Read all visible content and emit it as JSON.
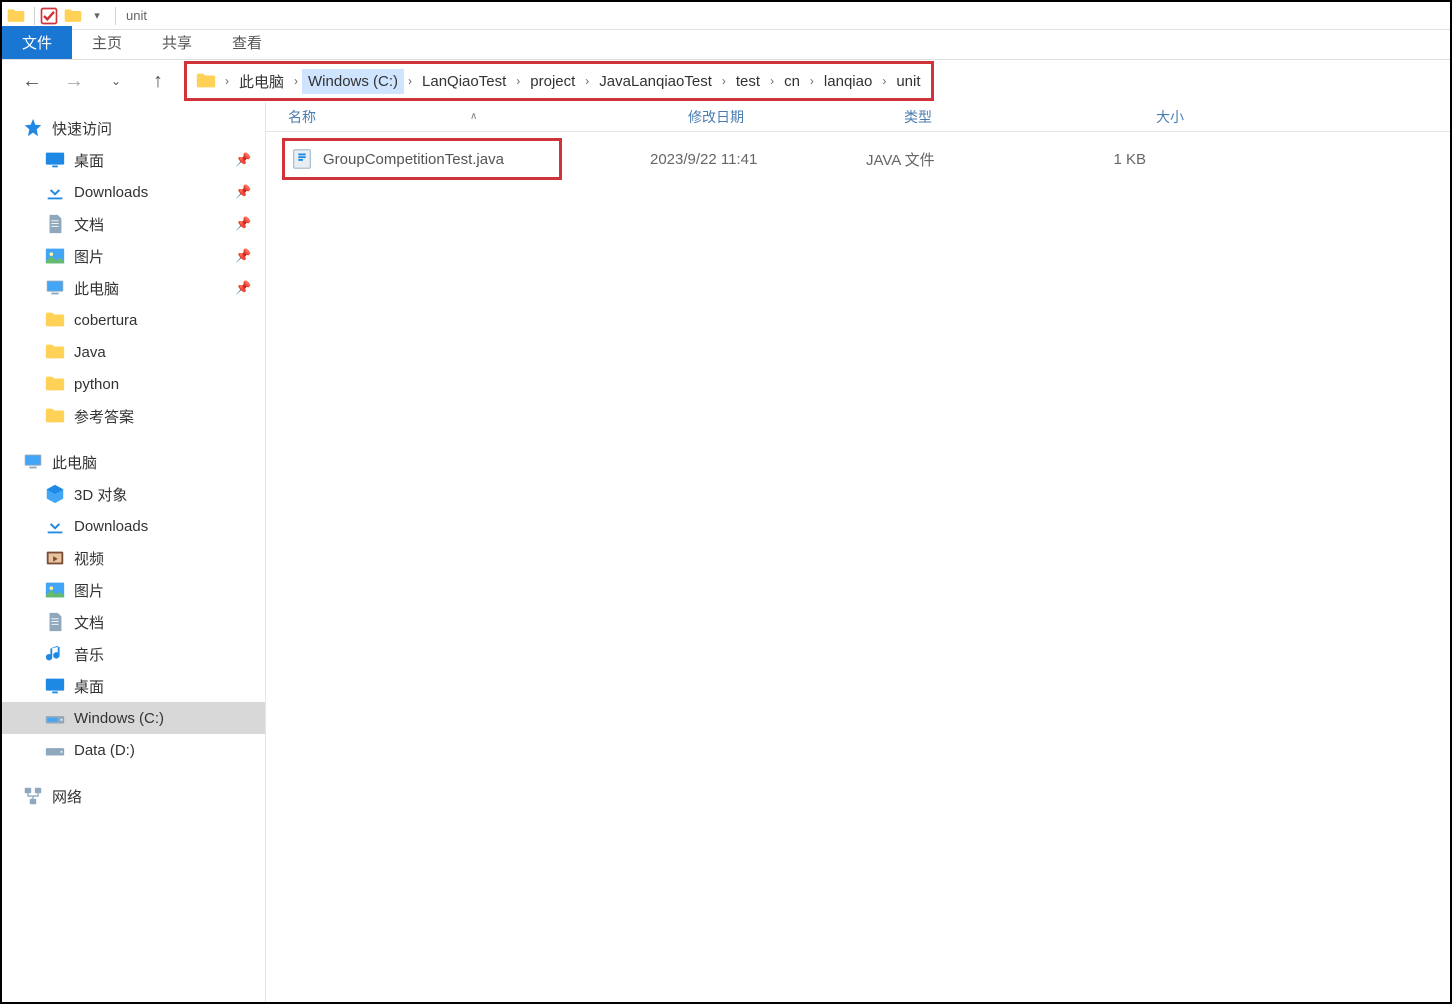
{
  "window": {
    "title": "unit"
  },
  "ribbon": {
    "tabs": [
      {
        "label": "文件",
        "active": true
      },
      {
        "label": "主页",
        "active": false
      },
      {
        "label": "共享",
        "active": false
      },
      {
        "label": "查看",
        "active": false
      }
    ]
  },
  "breadcrumb": {
    "items": [
      {
        "label": "此电脑",
        "highlighted": false
      },
      {
        "label": "Windows (C:)",
        "highlighted": true
      },
      {
        "label": "LanQiaoTest",
        "highlighted": false
      },
      {
        "label": "project",
        "highlighted": false
      },
      {
        "label": "JavaLanqiaoTest",
        "highlighted": false
      },
      {
        "label": "test",
        "highlighted": false
      },
      {
        "label": "cn",
        "highlighted": false
      },
      {
        "label": "lanqiao",
        "highlighted": false
      },
      {
        "label": "unit",
        "highlighted": false
      }
    ]
  },
  "sidebar": {
    "quick_access": {
      "label": "快速访问",
      "items": [
        {
          "label": "桌面",
          "icon": "desktop",
          "pinned": true
        },
        {
          "label": "Downloads",
          "icon": "download",
          "pinned": true
        },
        {
          "label": "文档",
          "icon": "document",
          "pinned": true
        },
        {
          "label": "图片",
          "icon": "picture",
          "pinned": true
        },
        {
          "label": "此电脑",
          "icon": "computer",
          "pinned": true
        },
        {
          "label": "cobertura",
          "icon": "folder",
          "pinned": false
        },
        {
          "label": "Java",
          "icon": "folder",
          "pinned": false
        },
        {
          "label": "python",
          "icon": "folder",
          "pinned": false
        },
        {
          "label": "参考答案",
          "icon": "folder",
          "pinned": false
        }
      ]
    },
    "this_pc": {
      "label": "此电脑",
      "items": [
        {
          "label": "3D 对象",
          "icon": "3d"
        },
        {
          "label": "Downloads",
          "icon": "download"
        },
        {
          "label": "视频",
          "icon": "video"
        },
        {
          "label": "图片",
          "icon": "picture"
        },
        {
          "label": "文档",
          "icon": "document"
        },
        {
          "label": "音乐",
          "icon": "music"
        },
        {
          "label": "桌面",
          "icon": "desktop"
        },
        {
          "label": "Windows (C:)",
          "icon": "drive",
          "selected": true
        },
        {
          "label": "Data (D:)",
          "icon": "drive"
        }
      ]
    },
    "network": {
      "label": "网络"
    }
  },
  "columns": {
    "name": "名称",
    "date": "修改日期",
    "type": "类型",
    "size": "大小"
  },
  "files": [
    {
      "name": "GroupCompetitionTest.java",
      "date": "2023/9/22 11:41",
      "type": "JAVA 文件",
      "size": "1 KB",
      "highlighted": true
    }
  ]
}
